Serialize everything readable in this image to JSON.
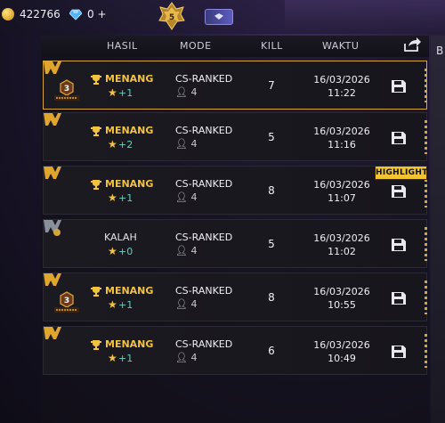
{
  "topbar": {
    "coins": "422766",
    "diamonds": "0 +",
    "rank_level": "5"
  },
  "table": {
    "headers": {
      "result": "HASIL",
      "mode": "MODE",
      "kill": "KILL",
      "time": "WAKTU"
    },
    "rows": [
      {
        "result": "MENANG",
        "points": "+1",
        "mode": "CS-RANKED",
        "team": "4",
        "kill": "7",
        "date": "16/03/2026",
        "time": "11:22",
        "booyah_rank": "3"
      },
      {
        "result": "MENANG",
        "points": "+2",
        "mode": "CS-RANKED",
        "team": "4",
        "kill": "5",
        "date": "16/03/2026",
        "time": "11:16"
      },
      {
        "result": "MENANG",
        "points": "+1",
        "mode": "CS-RANKED",
        "team": "4",
        "kill": "8",
        "date": "16/03/2026",
        "time": "11:07"
      },
      {
        "result": "KALAH",
        "points": "+0",
        "mode": "CS-RANKED",
        "team": "4",
        "kill": "5",
        "date": "16/03/2026",
        "time": "11:02"
      },
      {
        "result": "MENANG",
        "points": "+1",
        "mode": "CS-RANKED",
        "team": "4",
        "kill": "8",
        "date": "16/03/2026",
        "time": "10:55",
        "booyah_rank": "3"
      },
      {
        "result": "MENANG",
        "points": "+1",
        "mode": "CS-RANKED",
        "team": "4",
        "kill": "6",
        "date": "16/03/2026",
        "time": "10:49"
      }
    ]
  },
  "highlight_label": "HIGHLIGHT",
  "side_tab_letter": "B",
  "colors": {
    "accent_gold": "#f2c341",
    "points_teal": "#59d3c2",
    "highlight_bg": "#f1c232"
  }
}
